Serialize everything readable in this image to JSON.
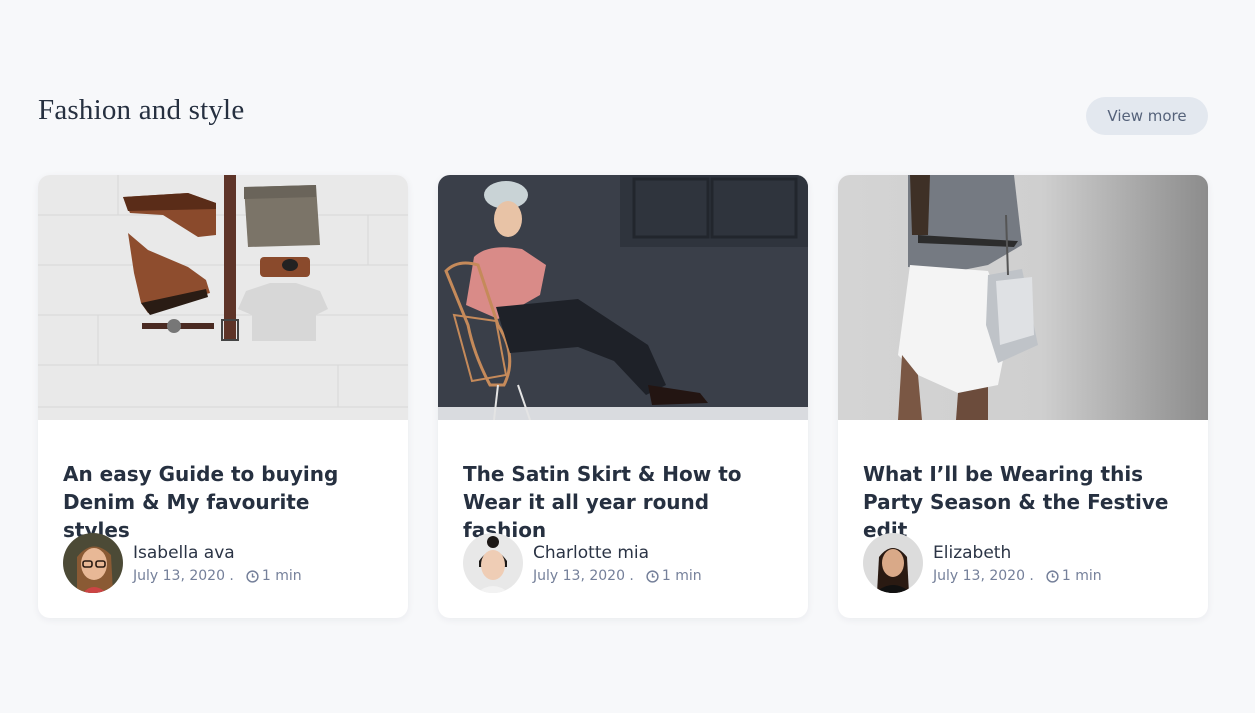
{
  "section": {
    "title": "Fashion and style",
    "view_more_label": "View more"
  },
  "posts": [
    {
      "title": "An easy Guide to buying Denim & My favourite styles",
      "author": "Isabella ava",
      "date": "July 13, 2020 .",
      "read_time": "1 min",
      "image_icon": "flat-lay-boots-belt-clothes-photo"
    },
    {
      "title": "The Satin Skirt & How to Wear it all year round fashion",
      "author": "Charlotte mia",
      "date": "July 13, 2020 .",
      "read_time": "1 min",
      "image_icon": "woman-on-chair-photo"
    },
    {
      "title": "What I’ll be Wearing this Party Season & the Festive edit",
      "author": "Elizabeth",
      "date": "July 13, 2020 .",
      "read_time": "1 min",
      "image_icon": "woman-with-handbag-photo"
    }
  ]
}
